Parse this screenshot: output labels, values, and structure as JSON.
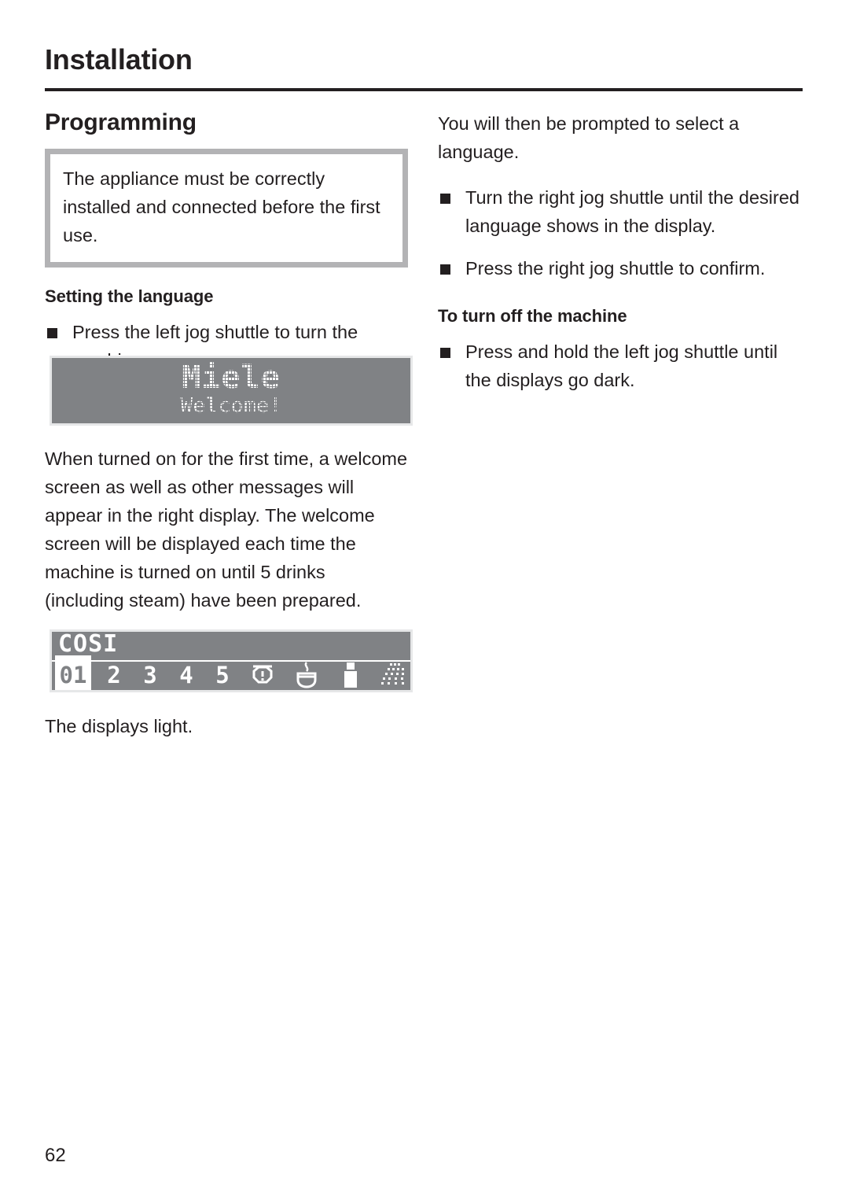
{
  "document": {
    "chapter_title": "Installation",
    "page_number": "62"
  },
  "left_column": {
    "section_title": "Programming",
    "note_box": {
      "text": "The appliance must be correctly installed and connected before the first use."
    },
    "sub_title": "Setting the language",
    "bullets": [
      "Press the left jog shuttle to turn the machine on."
    ],
    "paragraph": "When turned on for the first time, a welcome screen as well as other messages will appear in the right display. The welcome screen will be displayed each time the machine is turned on until 5 drinks (including steam) have been prepared.",
    "closing_text": "The displays light."
  },
  "right_column": {
    "intro_paragraph": "You will then be prompted to select a language.",
    "bullets": [
      "Turn the right jog shuttle until the desired language shows in the display.",
      "Press the right jog shuttle to confirm."
    ],
    "sub_title": "To turn off the machine",
    "bullets2": [
      "Press and hold the left jog shuttle until the displays go dark."
    ]
  },
  "lcd_welcome": {
    "brand_line": "Miele",
    "greeting_line": "Welcome!"
  },
  "lcd_select": {
    "label": "COSI",
    "selected_value": "01",
    "numbers": [
      "2",
      "3",
      "4",
      "5"
    ],
    "icons": [
      "timer-icon",
      "cup-icon",
      "portion-icon",
      "rinse-icon",
      "flow-arrow-icon",
      "settings-sliders-icon"
    ]
  },
  "colors": {
    "lcd_background": "#808285",
    "lcd_text": "#ffffff",
    "note_box_border": "#b3b3b5",
    "body_text": "#231f20"
  }
}
